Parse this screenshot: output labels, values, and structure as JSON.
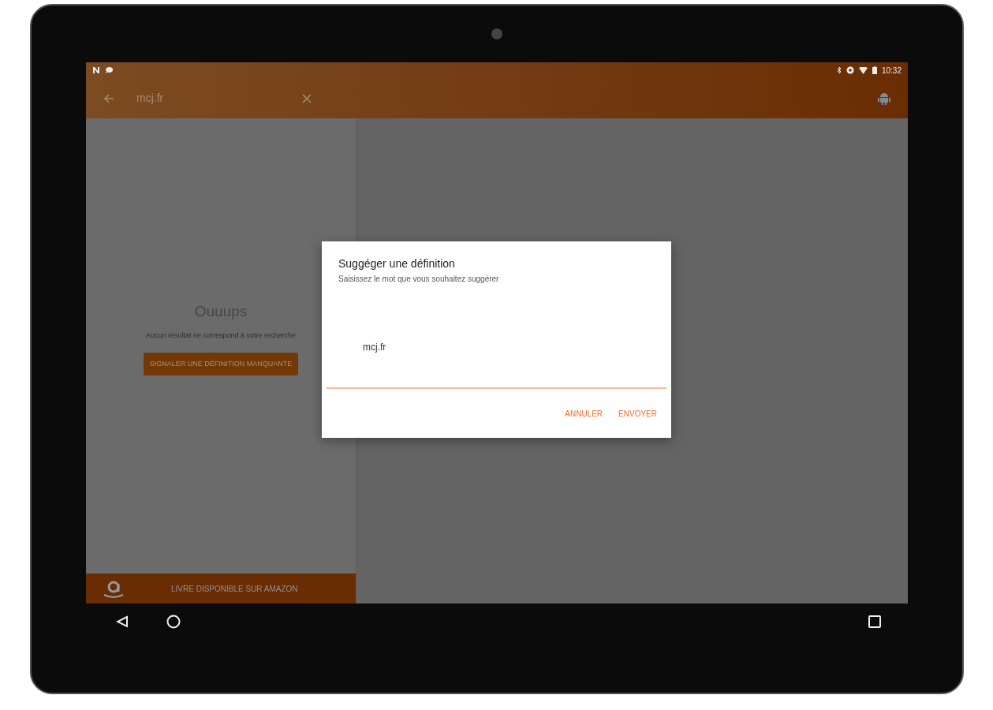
{
  "status_bar": {
    "time": "10:32"
  },
  "toolbar": {
    "search_value": "mcj.fr"
  },
  "empty_state": {
    "title": "Ouuups",
    "message": "Aucun résultat ne correspond à votre recherche",
    "button": "SIGNALER UNE DÉFINITION MANQUANTE"
  },
  "bottom_banner": {
    "label": "LIVRE DISPONIBLE SUR AMAZON"
  },
  "dialog": {
    "title": "Suggéger une définition",
    "subtitle": "Saisissez le mot que vous souhaitez suggérer",
    "input_value": "mcj.fr",
    "buttons": [
      "ANNULER",
      "ENVOYER"
    ]
  }
}
